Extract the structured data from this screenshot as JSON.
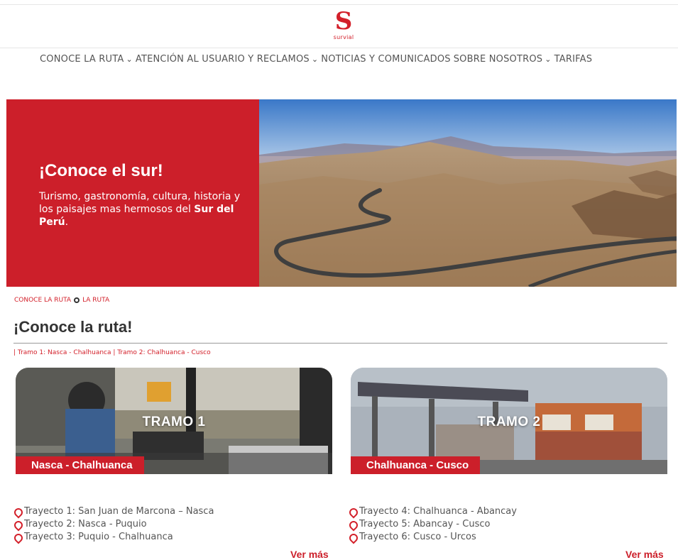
{
  "brand": {
    "logo_letter": "S",
    "logo_text": "survial",
    "accent": "#cc1f2a"
  },
  "nav": [
    {
      "label": "CONOCE LA RUTA",
      "caret": "⌄",
      "has_dropdown": true
    },
    {
      "label": "ATENCIÓN AL USUARIO Y RECLAMOS",
      "caret": "⌄",
      "has_dropdown": true
    },
    {
      "label": "NOTICIAS Y COMUNICADOS",
      "caret": "",
      "has_dropdown": false
    },
    {
      "label": "SOBRE NOSOTROS",
      "caret": "⌄",
      "has_dropdown": true
    },
    {
      "label": "TARIFAS",
      "caret": "",
      "has_dropdown": false
    }
  ],
  "hero": {
    "title": "¡Conoce el sur!",
    "text_pre": "Turismo, gastronomía, cultura, historia y los paisajes mas hermosos del ",
    "text_bold": "Sur del Perú",
    "text_post": "."
  },
  "breadcrumb": {
    "parent": "CONOCE LA RUTA",
    "current": "LA RUTA"
  },
  "section": {
    "title": "¡Conoce la ruta!",
    "sub_links": "| Tramo 1: Nasca - Chalhuanca | Tramo 2: Chalhuanca - Cusco"
  },
  "cards": [
    {
      "title": "TRAMO 1",
      "label": "Nasca - Chalhuanca",
      "routes": [
        "Trayecto 1: San Juan de Marcona – Nasca",
        "Trayecto 2: Nasca - Puquio",
        "Trayecto 3: Puquio - Chalhuanca"
      ],
      "more": "Ver más"
    },
    {
      "title": "TRAMO 2",
      "label": "Chalhuanca - Cusco",
      "routes": [
        "Trayecto 4: Chalhuanca - Abancay",
        "Trayecto 5: Abancay - Cusco",
        "Trayecto 6: Cusco - Urcos"
      ],
      "more": "Ver más"
    }
  ]
}
